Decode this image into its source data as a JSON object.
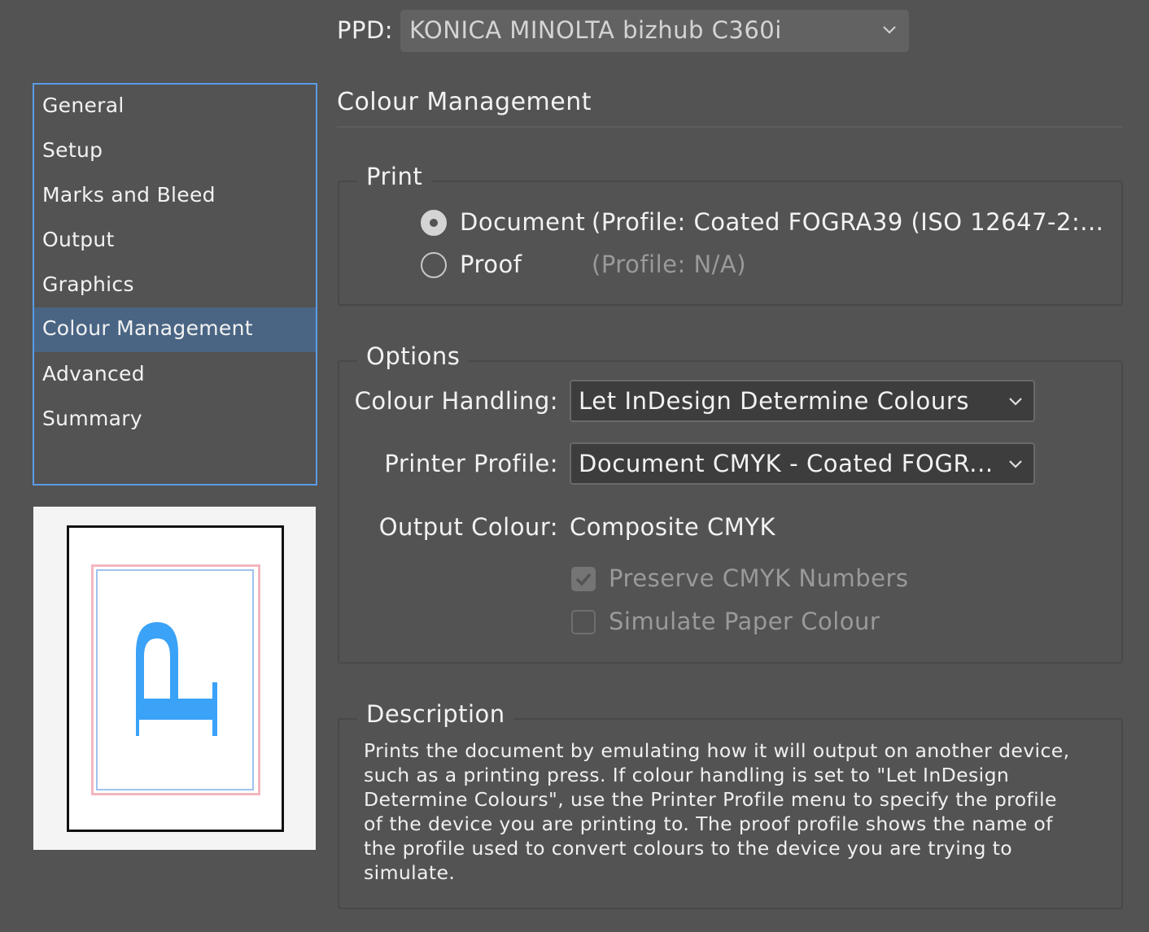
{
  "ppd": {
    "label": "PPD:",
    "value": "KONICA MINOLTA bizhub C360i"
  },
  "sidebar": {
    "items": [
      {
        "label": "General"
      },
      {
        "label": "Setup"
      },
      {
        "label": "Marks and Bleed"
      },
      {
        "label": "Output"
      },
      {
        "label": "Graphics"
      },
      {
        "label": "Colour Management",
        "selected": true
      },
      {
        "label": "Advanced"
      },
      {
        "label": "Summary"
      }
    ]
  },
  "panel": {
    "title": "Colour Management",
    "print": {
      "legend": "Print",
      "document_label": "Document",
      "document_profile": "(Profile: Coated FOGRA39 (ISO 12647-2:...",
      "proof_label": "Proof",
      "proof_profile": "(Profile: N/A)",
      "selected": "Document"
    },
    "options": {
      "legend": "Options",
      "colour_handling_label": "Colour Handling:",
      "colour_handling_value": "Let InDesign Determine Colours",
      "printer_profile_label": "Printer Profile:",
      "printer_profile_value": "Document CMYK - Coated FOGR...",
      "output_colour_label": "Output Colour:",
      "output_colour_value": "Composite CMYK",
      "preserve_cmyk_label": "Preserve CMYK Numbers",
      "preserve_cmyk_checked": true,
      "simulate_paper_label": "Simulate Paper Colour",
      "simulate_paper_checked": false
    },
    "description": {
      "legend": "Description",
      "lines": [
        "Prints the document by emulating how it will output on another device,",
        "such as a printing press. If colour handling is set to \"Let InDesign",
        "Determine Colours\", use the Printer Profile menu to specify the profile",
        "of the device you are printing to. The proof profile shows the name of",
        "the profile used to convert colours to the device you are trying to",
        "simulate."
      ]
    }
  },
  "colors": {
    "background": "#535353",
    "selection": "#4a6584",
    "focus_ring": "#5a9ce6",
    "preview_glyph": "#3aa2f7"
  }
}
